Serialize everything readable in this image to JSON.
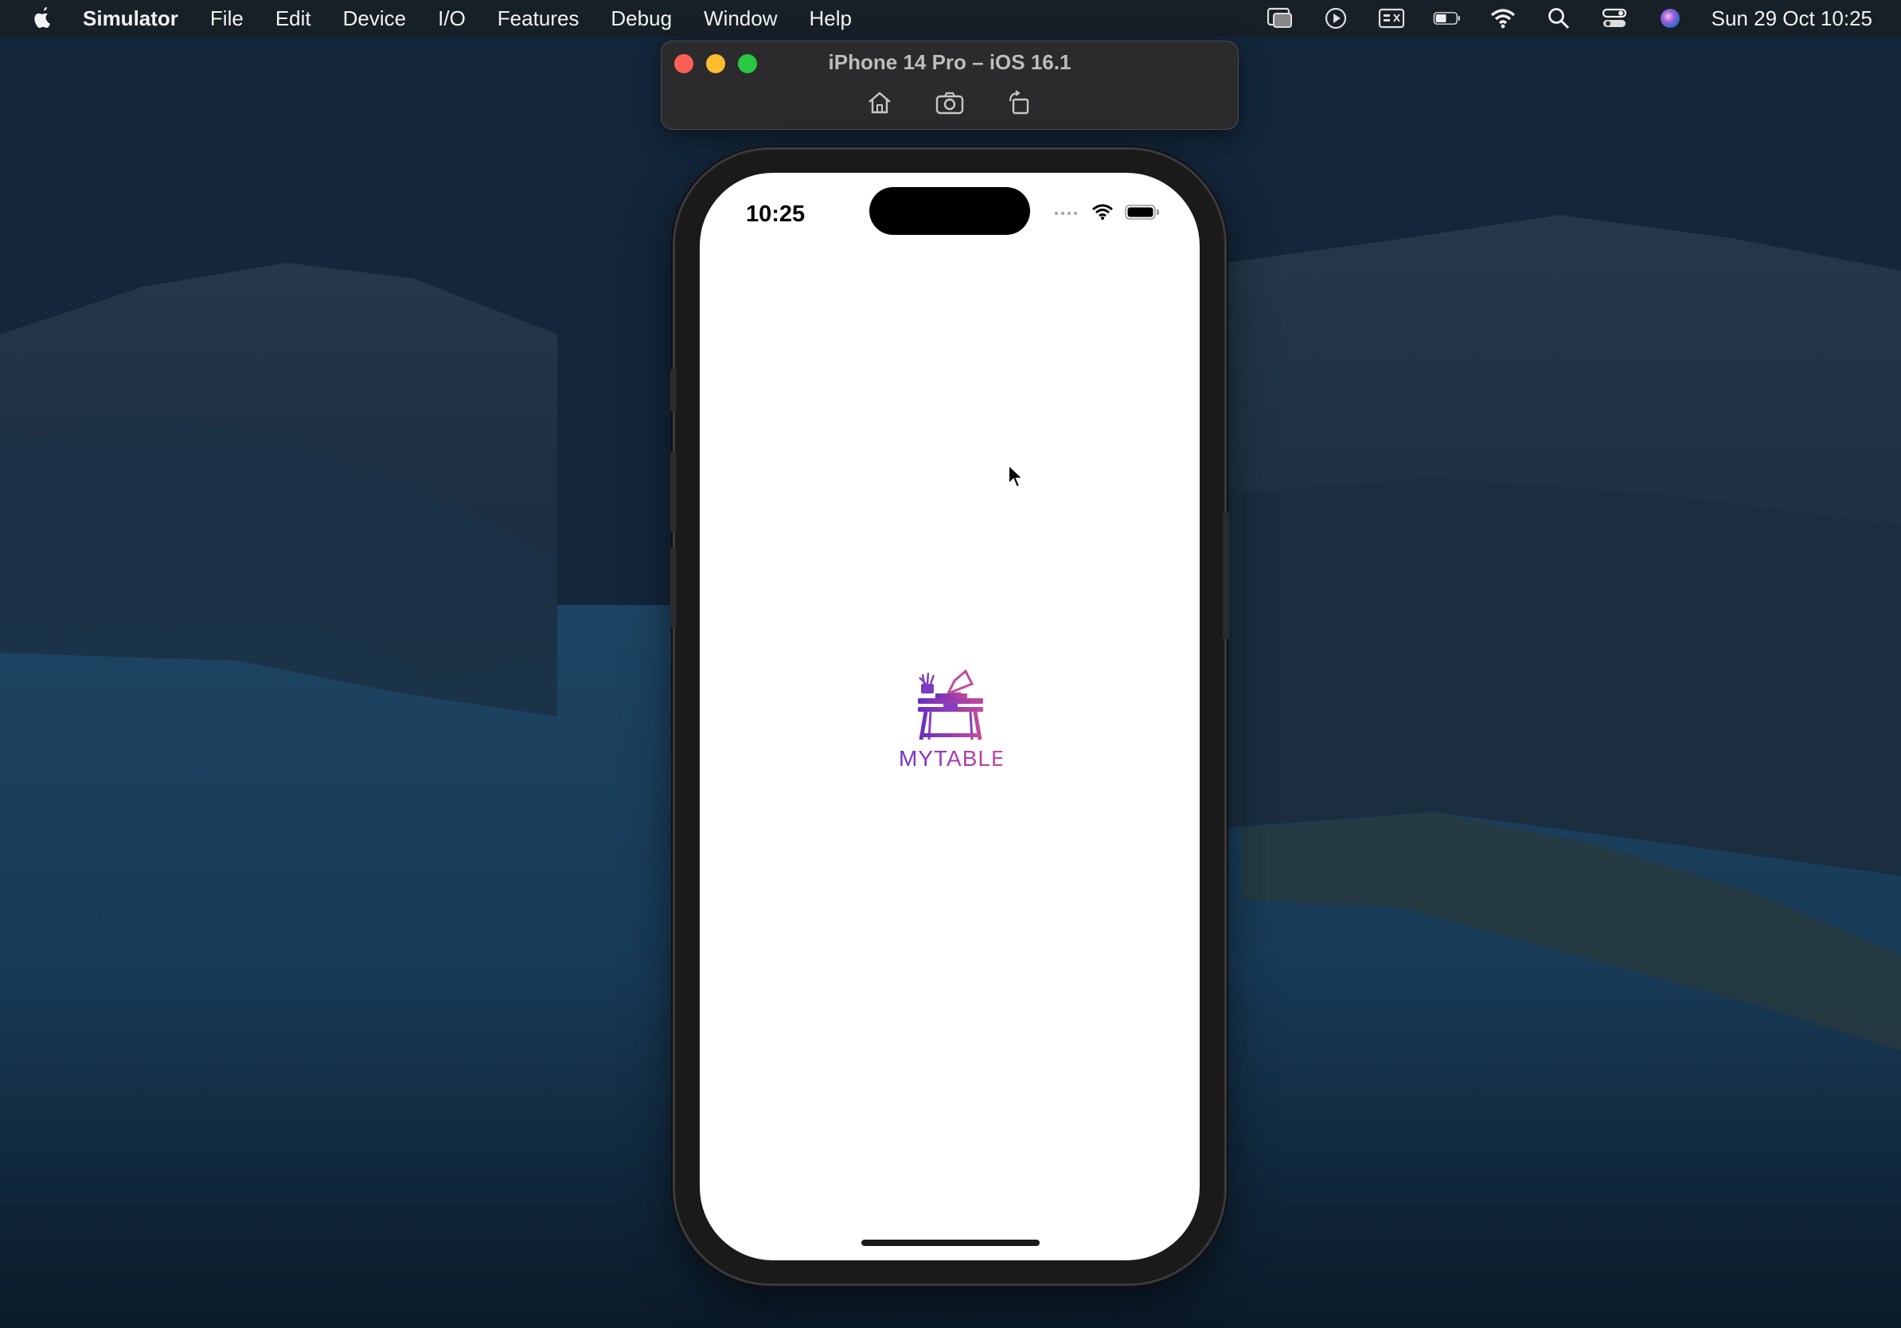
{
  "menubar": {
    "app_name": "Simulator",
    "items": [
      "File",
      "Edit",
      "Device",
      "I/O",
      "Features",
      "Debug",
      "Window",
      "Help"
    ],
    "clock": "Sun 29 Oct  10:25",
    "status_icons": [
      "screen-mirroring-icon",
      "play-icon",
      "keyboard-input-icon",
      "battery-icon",
      "wifi-icon",
      "spotlight-search-icon",
      "control-center-icon",
      "siri-icon"
    ]
  },
  "simulator_window": {
    "title": "iPhone 14 Pro – iOS 16.1",
    "tools": [
      "home-icon",
      "screenshot-icon",
      "rotate-icon"
    ]
  },
  "phone": {
    "status_time": "10:25",
    "logo_text": "MYTABLE"
  },
  "colors": {
    "logo_purple": "#6b2fbf",
    "logo_pink": "#c24a9c",
    "close": "#ff5f57",
    "minimize": "#febc2e",
    "maximize": "#28c840"
  }
}
